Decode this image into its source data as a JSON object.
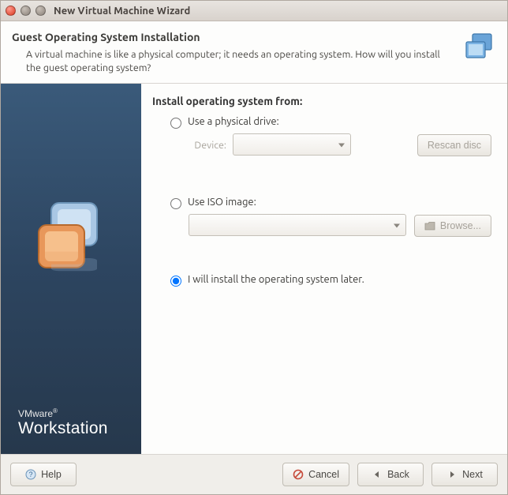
{
  "window": {
    "title": "New Virtual Machine Wizard"
  },
  "header": {
    "title": "Guest Operating System Installation",
    "subtitle": "A virtual machine is like a physical computer; it needs an operating system. How will you install the guest operating system?"
  },
  "content": {
    "section_label": "Install operating system from:",
    "options": {
      "physical": {
        "label": "Use a physical drive:",
        "device_label": "Device:",
        "device_value": "",
        "rescan_label": "Rescan disc"
      },
      "iso": {
        "label": "Use ISO image:",
        "path_value": "",
        "browse_label": "Browse..."
      },
      "later": {
        "label": "I will install the operating system later."
      }
    },
    "selected": "later"
  },
  "sidebar": {
    "brand_small": "VMware",
    "brand_big": "Workstation"
  },
  "footer": {
    "help": "Help",
    "cancel": "Cancel",
    "back": "Back",
    "next": "Next"
  }
}
